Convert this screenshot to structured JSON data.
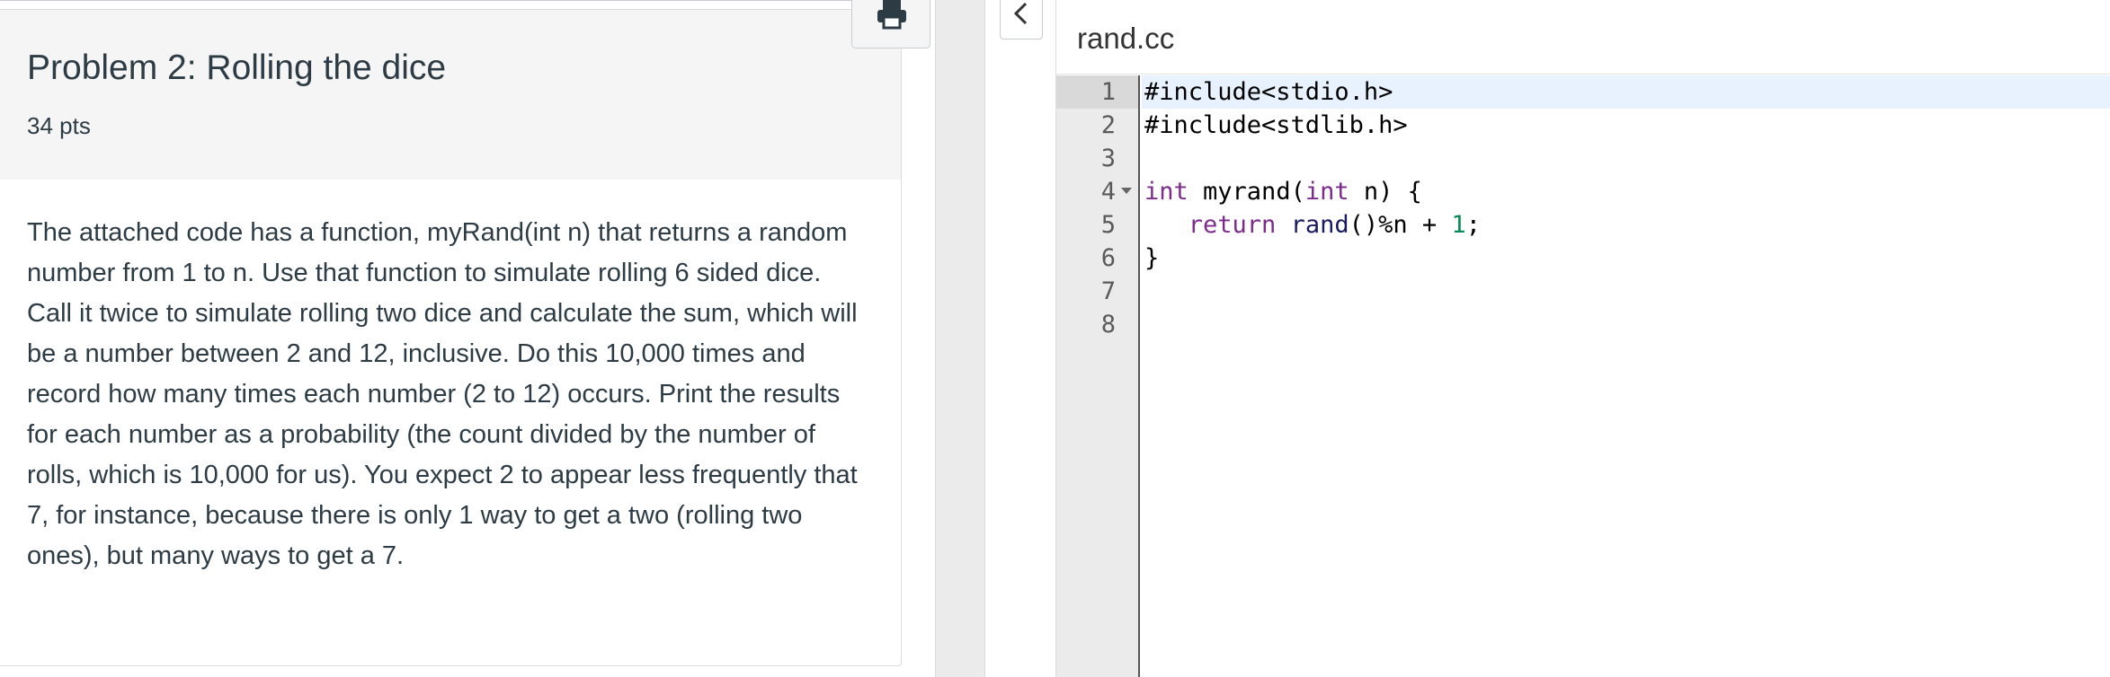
{
  "question": {
    "title": "Problem 2: Rolling the dice",
    "points": "34 pts",
    "text": "The attached code has a function, myRand(int n) that returns a random number from 1 to n. Use that function to simulate rolling 6 sided dice. Call it twice to simulate rolling two dice and calculate the sum, which will be a number between 2 and 12, inclusive. Do this 10,000 times and record how many times each number (2 to 12) occurs. Print the results for each number as a probability (the count divided by the number of rolls, which is 10,000 for us). You expect 2 to appear less frequently that 7, for instance, because there is only 1 way to get a two (rolling two ones), but many ways to get a 7.",
    "print_icon": "print-icon"
  },
  "panel": {
    "collapse_icon": "chevron-left-icon"
  },
  "editor": {
    "file_name": "rand.cc",
    "line_numbers": [
      "1",
      "2",
      "3",
      "4",
      "5",
      "6",
      "7",
      "8"
    ],
    "lines": [
      {
        "tokens": [
          {
            "t": "plain",
            "v": "#include<stdio.h>"
          }
        ]
      },
      {
        "tokens": [
          {
            "t": "plain",
            "v": "#include<stdlib.h>"
          }
        ]
      },
      {
        "tokens": []
      },
      {
        "tokens": [
          {
            "t": "keyword",
            "v": "int"
          },
          {
            "t": "plain",
            "v": " myrand("
          },
          {
            "t": "keyword",
            "v": "int"
          },
          {
            "t": "plain",
            "v": " n) {"
          }
        ]
      },
      {
        "tokens": [
          {
            "t": "plain",
            "v": "   "
          },
          {
            "t": "keyword",
            "v": "return"
          },
          {
            "t": "plain",
            "v": " "
          },
          {
            "t": "fn",
            "v": "rand"
          },
          {
            "t": "plain",
            "v": "()%n + "
          },
          {
            "t": "num",
            "v": "1"
          },
          {
            "t": "plain",
            "v": ";"
          }
        ]
      },
      {
        "tokens": [
          {
            "t": "plain",
            "v": "}"
          }
        ]
      },
      {
        "tokens": []
      },
      {
        "tokens": []
      }
    ],
    "active_line": 1,
    "fold_line": 4
  }
}
